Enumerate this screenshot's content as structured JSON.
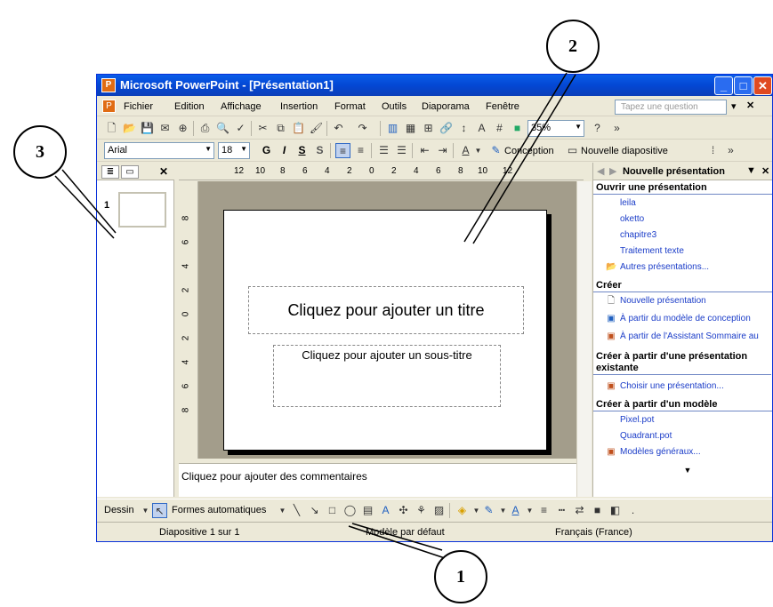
{
  "window": {
    "title": "Microsoft PowerPoint - [Présentation1]",
    "minimize": "_",
    "maximize": "□",
    "close": "✕"
  },
  "menu": {
    "items": [
      "Fichier",
      "Edition",
      "Affichage",
      "Insertion",
      "Format",
      "Outils",
      "Diaporama",
      "Fenêtre"
    ],
    "ask_placeholder": "Tapez une question",
    "close": "✕"
  },
  "toolbar": {
    "zoom": "35%",
    "font": "Arial",
    "size": "18",
    "bold": "G",
    "italic": "I",
    "underline": "S",
    "shadow": "S",
    "conception": "Conception",
    "new_slide": "Nouvelle diapositive"
  },
  "outline": {
    "slide_number": "1",
    "close": "✕"
  },
  "ruler": {
    "h": [
      "12",
      "10",
      "8",
      "6",
      "4",
      "2",
      "0",
      "2",
      "4",
      "6",
      "8",
      "10",
      "12"
    ],
    "v": [
      "8",
      "6",
      "4",
      "2",
      "0",
      "2",
      "4",
      "6",
      "8"
    ]
  },
  "slide": {
    "title_placeholder": "Cliquez pour ajouter un titre",
    "subtitle_placeholder": "Cliquez pour ajouter un sous-titre"
  },
  "notes": {
    "placeholder": "Cliquez pour ajouter des commentaires"
  },
  "taskpane": {
    "title": "Nouvelle présentation",
    "sections": {
      "open": "Ouvrir une présentation",
      "create": "Créer",
      "from_existing": "Créer à partir d'une présentation existante",
      "from_template": "Créer à partir d'un modèle"
    },
    "recent": [
      "leila",
      "oketto",
      "chapitre3",
      "Traitement texte"
    ],
    "more": "Autres présentations...",
    "create_items": [
      "Nouvelle présentation",
      "À partir du modèle de conception",
      "À partir de l'Assistant Sommaire au"
    ],
    "choose": "Choisir une présentation...",
    "templates": [
      "Pixel.pot",
      "Quadrant.pot"
    ],
    "general": "Modèles généraux..."
  },
  "drawbar": {
    "dessin": "Dessin",
    "autoshapes": "Formes automatiques"
  },
  "status": {
    "slide": "Diapositive 1 sur 1",
    "design": "Modèle par défaut",
    "language": "Français (France)"
  },
  "callouts": [
    "1",
    "2",
    "3"
  ]
}
